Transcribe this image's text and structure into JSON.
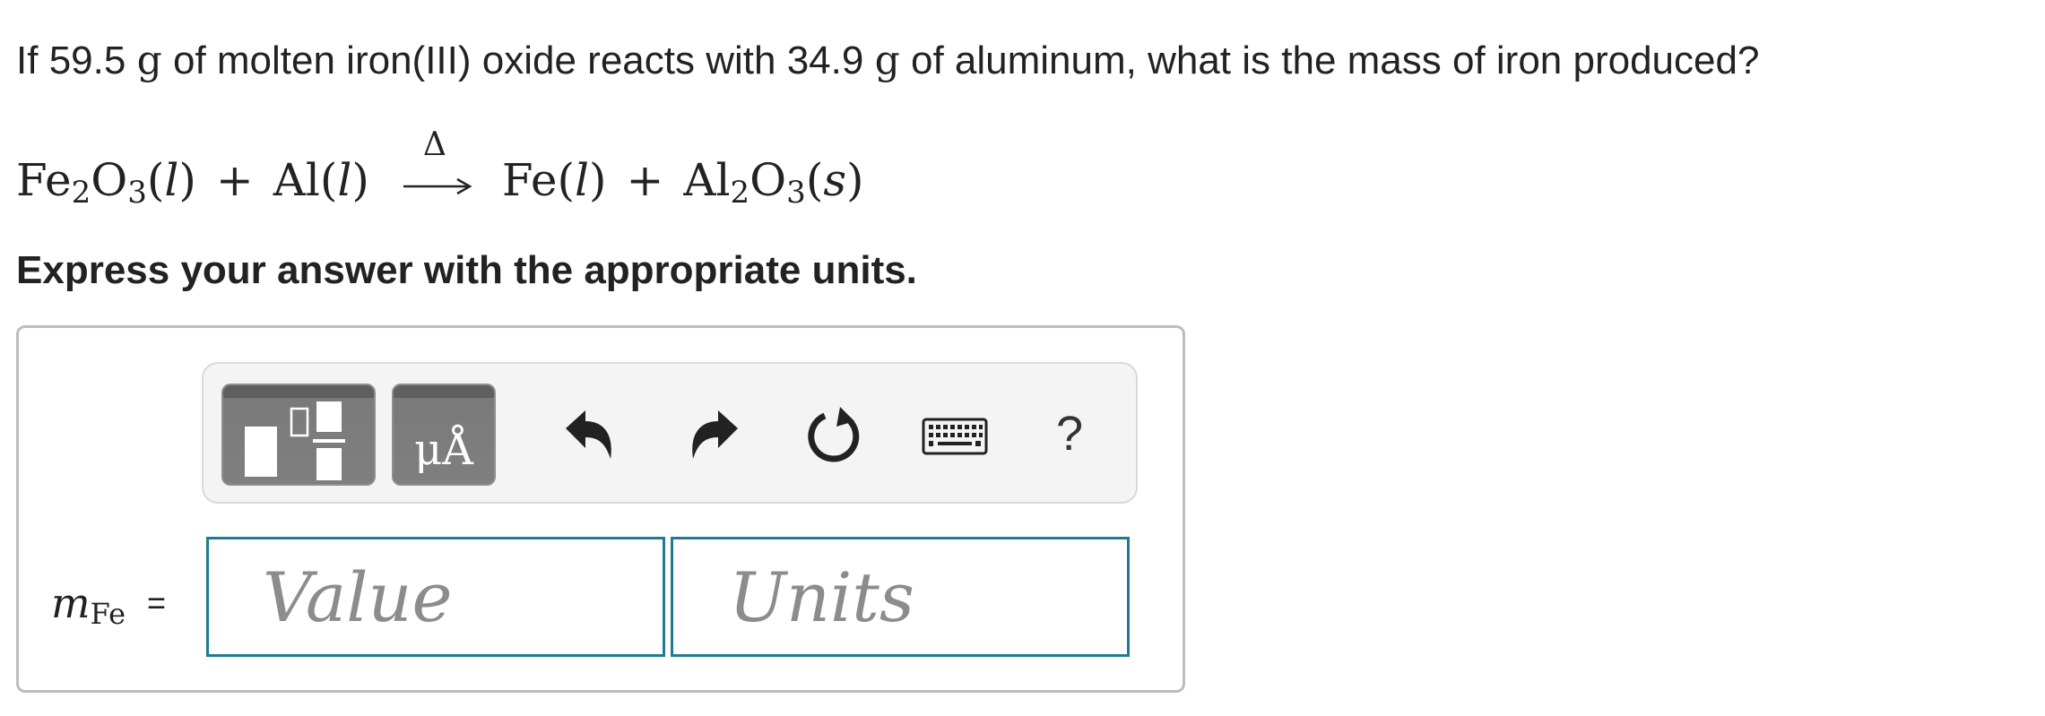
{
  "question": {
    "prefix": "If",
    "iron_oxide_mass": "59.5",
    "unit_1": "g",
    "middle": "of molten iron(III) oxide reacts with",
    "aluminum_mass": "34.9",
    "unit_2": "g",
    "suffix": "of aluminum, what is the mass of iron produced?"
  },
  "equation": {
    "reactant_1": {
      "base_1": "Fe",
      "sub_1": "2",
      "base_2": "O",
      "sub_2": "3",
      "state": "l"
    },
    "plus_1": "+",
    "reactant_2": {
      "base": "Al",
      "state": "l"
    },
    "arrow_label": "Δ",
    "product_1": {
      "base": "Fe",
      "state": "l"
    },
    "plus_2": "+",
    "product_2": {
      "base_1": "Al",
      "sub_1": "2",
      "base_2": "O",
      "sub_2": "3",
      "state": "s"
    }
  },
  "instruction": "Express your answer with the appropriate units.",
  "toolbar": {
    "symbols_label": "μÅ",
    "help_label": "?"
  },
  "answer": {
    "variable": "m",
    "variable_subscript": "Fe",
    "equals": "=",
    "value": "",
    "value_placeholder": "Value",
    "units": "",
    "units_placeholder": "Units"
  },
  "colors": {
    "input_border": "#1f7b94",
    "toolbar_button": "#7a7a7a",
    "toolbar_background": "#f4f4f4",
    "panel_border": "#bdbdbd"
  },
  "icons": [
    "templates-icon",
    "undo-icon",
    "redo-icon",
    "reset-icon",
    "keyboard-icon",
    "help-icon"
  ]
}
